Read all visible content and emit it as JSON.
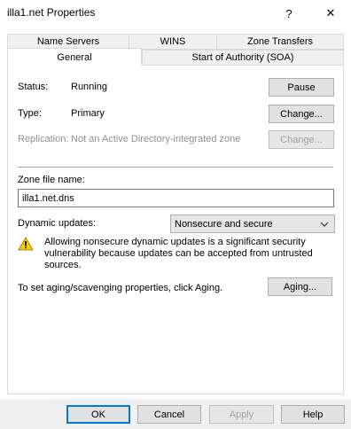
{
  "window": {
    "title": "illa1.net Properties",
    "help_glyph": "?",
    "close_glyph": "✕"
  },
  "tabs": {
    "row1": [
      "Name Servers",
      "WINS",
      "Zone Transfers"
    ],
    "row2": [
      "General",
      "Start of Authority (SOA)"
    ],
    "active": "General"
  },
  "general": {
    "status_label": "Status:",
    "status_value": "Running",
    "pause_label": "Pause",
    "type_label": "Type:",
    "type_value": "Primary",
    "change_label": "Change...",
    "replication_label": "Replication:",
    "replication_value": "Not an Active Directory-integrated zone",
    "change_repl_label": "Change...",
    "zone_file_label": "Zone file name:",
    "zone_file_value": "illa1.net.dns",
    "dynamic_label": "Dynamic updates:",
    "dynamic_value": "Nonsecure and secure",
    "warning_text": "Allowing nonsecure dynamic updates is a significant security vulnerability because updates can be accepted from untrusted sources.",
    "aging_text": "To set aging/scavenging properties, click Aging.",
    "aging_label": "Aging..."
  },
  "footer": {
    "ok": "OK",
    "cancel": "Cancel",
    "apply": "Apply",
    "help": "Help"
  },
  "colors": {
    "accent": "#0078d7",
    "warning": "#ffcc00"
  },
  "icons": {
    "warning": "warning-icon",
    "dropdown": "chevron-down-icon"
  }
}
